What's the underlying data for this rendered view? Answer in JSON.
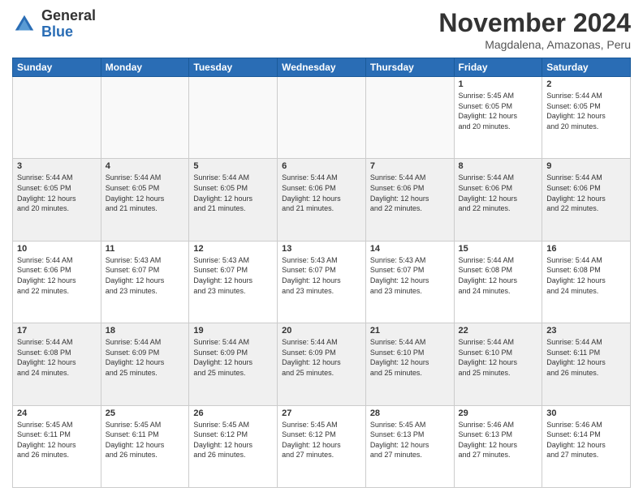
{
  "logo": {
    "general": "General",
    "blue": "Blue"
  },
  "title": "November 2024",
  "location": "Magdalena, Amazonas, Peru",
  "headers": [
    "Sunday",
    "Monday",
    "Tuesday",
    "Wednesday",
    "Thursday",
    "Friday",
    "Saturday"
  ],
  "weeks": [
    [
      {
        "day": "",
        "info": ""
      },
      {
        "day": "",
        "info": ""
      },
      {
        "day": "",
        "info": ""
      },
      {
        "day": "",
        "info": ""
      },
      {
        "day": "",
        "info": ""
      },
      {
        "day": "1",
        "info": "Sunrise: 5:45 AM\nSunset: 6:05 PM\nDaylight: 12 hours\nand 20 minutes."
      },
      {
        "day": "2",
        "info": "Sunrise: 5:44 AM\nSunset: 6:05 PM\nDaylight: 12 hours\nand 20 minutes."
      }
    ],
    [
      {
        "day": "3",
        "info": "Sunrise: 5:44 AM\nSunset: 6:05 PM\nDaylight: 12 hours\nand 20 minutes."
      },
      {
        "day": "4",
        "info": "Sunrise: 5:44 AM\nSunset: 6:05 PM\nDaylight: 12 hours\nand 21 minutes."
      },
      {
        "day": "5",
        "info": "Sunrise: 5:44 AM\nSunset: 6:05 PM\nDaylight: 12 hours\nand 21 minutes."
      },
      {
        "day": "6",
        "info": "Sunrise: 5:44 AM\nSunset: 6:06 PM\nDaylight: 12 hours\nand 21 minutes."
      },
      {
        "day": "7",
        "info": "Sunrise: 5:44 AM\nSunset: 6:06 PM\nDaylight: 12 hours\nand 22 minutes."
      },
      {
        "day": "8",
        "info": "Sunrise: 5:44 AM\nSunset: 6:06 PM\nDaylight: 12 hours\nand 22 minutes."
      },
      {
        "day": "9",
        "info": "Sunrise: 5:44 AM\nSunset: 6:06 PM\nDaylight: 12 hours\nand 22 minutes."
      }
    ],
    [
      {
        "day": "10",
        "info": "Sunrise: 5:44 AM\nSunset: 6:06 PM\nDaylight: 12 hours\nand 22 minutes."
      },
      {
        "day": "11",
        "info": "Sunrise: 5:43 AM\nSunset: 6:07 PM\nDaylight: 12 hours\nand 23 minutes."
      },
      {
        "day": "12",
        "info": "Sunrise: 5:43 AM\nSunset: 6:07 PM\nDaylight: 12 hours\nand 23 minutes."
      },
      {
        "day": "13",
        "info": "Sunrise: 5:43 AM\nSunset: 6:07 PM\nDaylight: 12 hours\nand 23 minutes."
      },
      {
        "day": "14",
        "info": "Sunrise: 5:43 AM\nSunset: 6:07 PM\nDaylight: 12 hours\nand 23 minutes."
      },
      {
        "day": "15",
        "info": "Sunrise: 5:44 AM\nSunset: 6:08 PM\nDaylight: 12 hours\nand 24 minutes."
      },
      {
        "day": "16",
        "info": "Sunrise: 5:44 AM\nSunset: 6:08 PM\nDaylight: 12 hours\nand 24 minutes."
      }
    ],
    [
      {
        "day": "17",
        "info": "Sunrise: 5:44 AM\nSunset: 6:08 PM\nDaylight: 12 hours\nand 24 minutes."
      },
      {
        "day": "18",
        "info": "Sunrise: 5:44 AM\nSunset: 6:09 PM\nDaylight: 12 hours\nand 25 minutes."
      },
      {
        "day": "19",
        "info": "Sunrise: 5:44 AM\nSunset: 6:09 PM\nDaylight: 12 hours\nand 25 minutes."
      },
      {
        "day": "20",
        "info": "Sunrise: 5:44 AM\nSunset: 6:09 PM\nDaylight: 12 hours\nand 25 minutes."
      },
      {
        "day": "21",
        "info": "Sunrise: 5:44 AM\nSunset: 6:10 PM\nDaylight: 12 hours\nand 25 minutes."
      },
      {
        "day": "22",
        "info": "Sunrise: 5:44 AM\nSunset: 6:10 PM\nDaylight: 12 hours\nand 25 minutes."
      },
      {
        "day": "23",
        "info": "Sunrise: 5:44 AM\nSunset: 6:11 PM\nDaylight: 12 hours\nand 26 minutes."
      }
    ],
    [
      {
        "day": "24",
        "info": "Sunrise: 5:45 AM\nSunset: 6:11 PM\nDaylight: 12 hours\nand 26 minutes."
      },
      {
        "day": "25",
        "info": "Sunrise: 5:45 AM\nSunset: 6:11 PM\nDaylight: 12 hours\nand 26 minutes."
      },
      {
        "day": "26",
        "info": "Sunrise: 5:45 AM\nSunset: 6:12 PM\nDaylight: 12 hours\nand 26 minutes."
      },
      {
        "day": "27",
        "info": "Sunrise: 5:45 AM\nSunset: 6:12 PM\nDaylight: 12 hours\nand 27 minutes."
      },
      {
        "day": "28",
        "info": "Sunrise: 5:45 AM\nSunset: 6:13 PM\nDaylight: 12 hours\nand 27 minutes."
      },
      {
        "day": "29",
        "info": "Sunrise: 5:46 AM\nSunset: 6:13 PM\nDaylight: 12 hours\nand 27 minutes."
      },
      {
        "day": "30",
        "info": "Sunrise: 5:46 AM\nSunset: 6:14 PM\nDaylight: 12 hours\nand 27 minutes."
      }
    ]
  ]
}
